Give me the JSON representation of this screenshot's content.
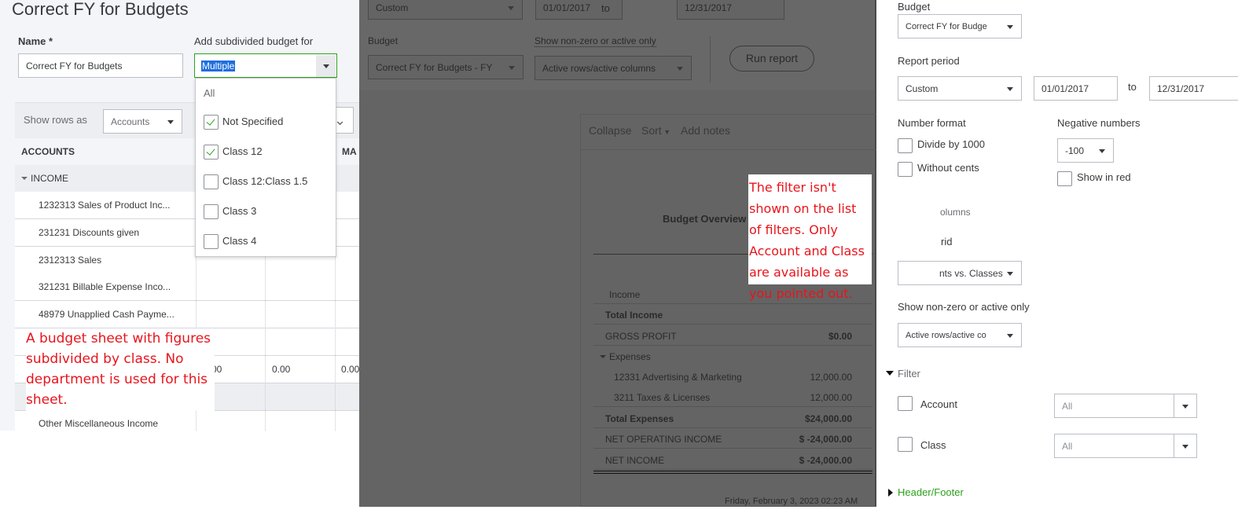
{
  "budget_editor": {
    "title": "Correct FY for Budgets",
    "name_label": "Name *",
    "name_value": "Correct FY for Budgets",
    "subdivide_label": "Add subdivided budget for",
    "subdivide_value": "Multiple",
    "dropdown_items": [
      {
        "label": "All"
      },
      {
        "label": "Not Specified",
        "checked": true
      },
      {
        "label": "Class 12",
        "checked": true
      },
      {
        "label": "Class 12:Class 1.5",
        "checked": false
      },
      {
        "label": "Class 3",
        "checked": false
      },
      {
        "label": "Class 4",
        "checked": false
      }
    ],
    "show_rows_label": "Show rows as",
    "show_rows_value": "Accounts",
    "col_accounts": "ACCOUNTS",
    "col_partial": "MA",
    "income_group": "INCOME",
    "rows": [
      "1232313 Sales of Product Inc...",
      "231231 Discounts given",
      "2312313 Sales",
      "321231 Billable Expense Inco...",
      "48979 Unapplied Cash Payme..."
    ],
    "total_values": [
      "00",
      "0.00",
      "0.00"
    ],
    "last_row": "Other Miscellaneous Income",
    "annotation": "A budget sheet with figures subdivided by class. No department is used for this sheet."
  },
  "report": {
    "period_value": "Custom",
    "date_from": "01/01/2017",
    "to_label": "to",
    "date_to": "12/31/2017",
    "budget_label": "Budget",
    "budget_value": "Correct FY for Budgets - FY",
    "nonzero_label": "Show non-zero or active only",
    "nonzero_value": "Active rows/active columns",
    "run_report": "Run report",
    "toolbar": {
      "collapse": "Collapse",
      "sort": "Sort",
      "add_notes": "Add notes"
    },
    "title": "Budget Overview",
    "rows": [
      {
        "label": "Income",
        "value": "",
        "bold": false
      },
      {
        "label": "Total Income",
        "value": "",
        "bold": true
      },
      {
        "label": "GROSS PROFIT",
        "value": "$0.00",
        "bold": false
      },
      {
        "label": "Expenses",
        "value": "",
        "bold": false
      },
      {
        "label": "12331 Advertising & Marketing",
        "value": "12,000.00",
        "bold": false
      },
      {
        "label": "3211 Taxes & Licenses",
        "value": "12,000.00",
        "bold": false
      },
      {
        "label": "Total Expenses",
        "value": "$24,000.00",
        "bold": true
      },
      {
        "label": "NET OPERATING INCOME",
        "value": "$ -24,000.00",
        "bold": false
      },
      {
        "label": "NET INCOME",
        "value": "$ -24,000.00",
        "bold": false
      }
    ],
    "footer": "Friday, February 3, 2023  02:23 AM",
    "annotation": "The filter isn't shown on the list of filters. Only Account and Class are available as you pointed out."
  },
  "customize": {
    "budget_label": "Budget",
    "budget_value": "Correct FY for Budge",
    "period_label": "Report period",
    "period_value": "Custom",
    "date_from": "01/01/2017",
    "to_label": "to",
    "date_to": "12/31/2017",
    "number_format_label": "Number format",
    "divide_1000": "Divide by 1000",
    "without_cents": "Without cents",
    "negative_label": "Negative numbers",
    "negative_value": "-100",
    "show_red": "Show in red",
    "partial_columns": "olumns",
    "partial_grid": "rid",
    "grid_value": "nts vs. Classes",
    "nonzero_label": "Show non-zero or active only",
    "nonzero_value": "Active rows/active co",
    "filter_label": "Filter",
    "filters": [
      {
        "label": "Account",
        "value": "All"
      },
      {
        "label": "Class",
        "value": "All"
      }
    ],
    "header_footer": "Header/Footer"
  },
  "colors": {
    "accent": "#2ca01c",
    "annotation": "#e8141c",
    "overlay": "#646464"
  }
}
